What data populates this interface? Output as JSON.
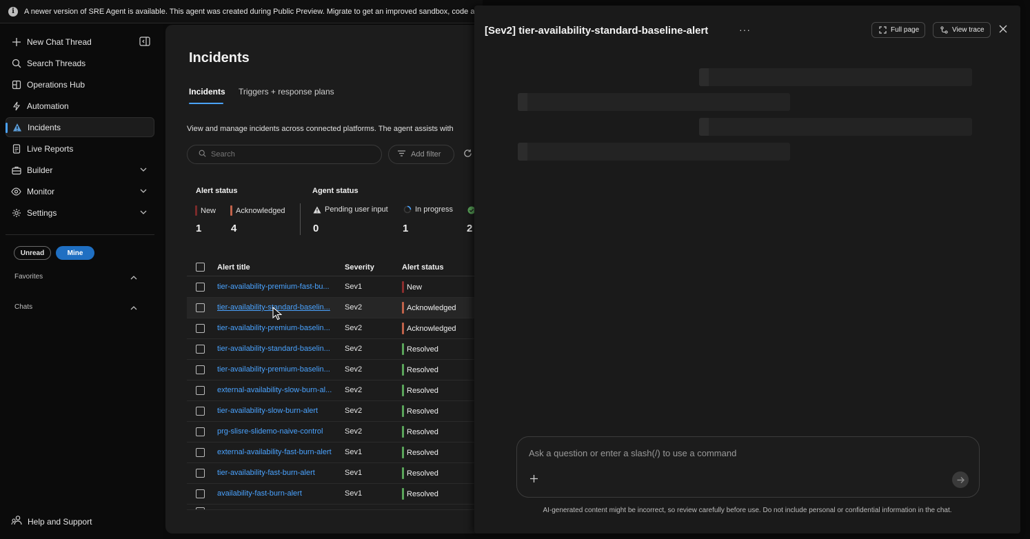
{
  "banner": {
    "text": "A newer version of SRE Agent is available. This agent was created during Public Preview. Migrate to get an improved sandbox, code and file access."
  },
  "sidebar": {
    "items": [
      {
        "label": "New Chat Thread",
        "icon": "plus-icon"
      },
      {
        "label": "Search Threads",
        "icon": "search-icon"
      },
      {
        "label": "Operations Hub",
        "icon": "book-icon"
      },
      {
        "label": "Automation",
        "icon": "lightning-icon"
      },
      {
        "label": "Incidents",
        "icon": "warning-icon"
      },
      {
        "label": "Live Reports",
        "icon": "report-icon"
      },
      {
        "label": "Builder",
        "icon": "briefcase-icon"
      },
      {
        "label": "Monitor",
        "icon": "eye-icon"
      },
      {
        "label": "Settings",
        "icon": "gear-icon"
      }
    ],
    "filters": {
      "unread": "Unread",
      "mine": "Mine"
    },
    "favorites": "Favorites",
    "chats": "Chats",
    "help": "Help and Support"
  },
  "incidents": {
    "title": "Incidents",
    "tabs": [
      "Incidents",
      "Triggers + response plans"
    ],
    "description": "View and manage incidents across connected platforms. The agent assists with",
    "search_placeholder": "Search",
    "add_filter": "Add filter",
    "alert_status": {
      "label": "Alert status",
      "new": {
        "label": "New",
        "count": "1",
        "color": "#7a2a2a"
      },
      "acknowledged": {
        "label": "Acknowledged",
        "count": "4",
        "color": "#c0624a"
      }
    },
    "agent_status": {
      "label": "Agent status",
      "pending": {
        "label": "Pending user input",
        "count": "0"
      },
      "in_progress": {
        "label": "In progress",
        "count": "1"
      },
      "completed_partial": "2"
    },
    "columns": [
      "Alert title",
      "Severity",
      "Alert status"
    ],
    "rows": [
      {
        "title": "tier-availability-premium-fast-bu...",
        "severity": "Sev1",
        "status": "New",
        "color": "#8b2e2e"
      },
      {
        "title": "tier-availability-standard-baselin...",
        "severity": "Sev2",
        "status": "Acknowledged",
        "color": "#c0624a"
      },
      {
        "title": "tier-availability-premium-baselin...",
        "severity": "Sev2",
        "status": "Acknowledged",
        "color": "#c0624a"
      },
      {
        "title": "tier-availability-standard-baselin...",
        "severity": "Sev2",
        "status": "Resolved",
        "color": "#5aa55a"
      },
      {
        "title": "tier-availability-premium-baselin...",
        "severity": "Sev2",
        "status": "Resolved",
        "color": "#5aa55a"
      },
      {
        "title": "external-availability-slow-burn-al...",
        "severity": "Sev2",
        "status": "Resolved",
        "color": "#5aa55a"
      },
      {
        "title": "tier-availability-slow-burn-alert",
        "severity": "Sev2",
        "status": "Resolved",
        "color": "#5aa55a"
      },
      {
        "title": "prg-slisre-slidemo-naive-control",
        "severity": "Sev2",
        "status": "Resolved",
        "color": "#5aa55a"
      },
      {
        "title": "external-availability-fast-burn-alert",
        "severity": "Sev1",
        "status": "Resolved",
        "color": "#5aa55a"
      },
      {
        "title": "tier-availability-fast-burn-alert",
        "severity": "Sev1",
        "status": "Resolved",
        "color": "#5aa55a"
      },
      {
        "title": "availability-fast-burn-alert",
        "severity": "Sev1",
        "status": "Resolved",
        "color": "#5aa55a"
      }
    ]
  },
  "panel": {
    "title": "[Sev2] tier-availability-standard-baseline-alert",
    "more": "···",
    "full_page": "Full page",
    "view_trace": "View trace",
    "chat_placeholder": "Ask a question or enter a slash(/) to use a command",
    "disclaimer": "AI-generated content might be incorrect, so review carefully before use. Do not include personal or confidential information in the chat."
  }
}
